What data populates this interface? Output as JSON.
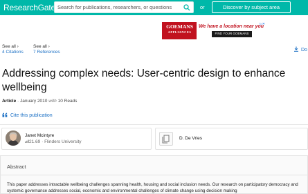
{
  "header": {
    "logo": "ResearchGate",
    "search_placeholder": "Search for publications, researchers, or questions",
    "or_text": "or",
    "discover_label": "Discover by subject area"
  },
  "ad": {
    "brand": "GOEMANS",
    "brand_sub": "APPLIANCES",
    "tagline": "We have a location near you",
    "button": "FIND YOUR GOEMANS",
    "close": "▷✕"
  },
  "stats": {
    "citations": {
      "see_all": "See all ›",
      "count": "4",
      "label": "Citations"
    },
    "references": {
      "see_all": "See all ›",
      "count": "7",
      "label": "References"
    },
    "download": "Do"
  },
  "publication": {
    "title": "Addressing complex needs: User-centric design to enhance wellbeing",
    "type": "Article",
    "sep1": " · ",
    "date": "January 2010",
    "with": "with",
    "reads": "10 Reads",
    "cite_label": "Cite this publication"
  },
  "authors": [
    {
      "name": "Janet Mcintyre",
      "score": "21.69",
      "affiliation": "Flinders University"
    },
    {
      "name": "D. De Vries"
    }
  ],
  "abstract": {
    "heading": "Abstract",
    "text": "This paper addresses intractable wellbeing challenges spanning health, housing and social inclusion needs. Our research on participatory democracy and systemic governance addresses social, economic and environmental challenges of climate change using decision making"
  },
  "colors": {
    "brand": "#00b8a9",
    "link": "#1a6fc4",
    "ad_red": "#c1121f"
  }
}
